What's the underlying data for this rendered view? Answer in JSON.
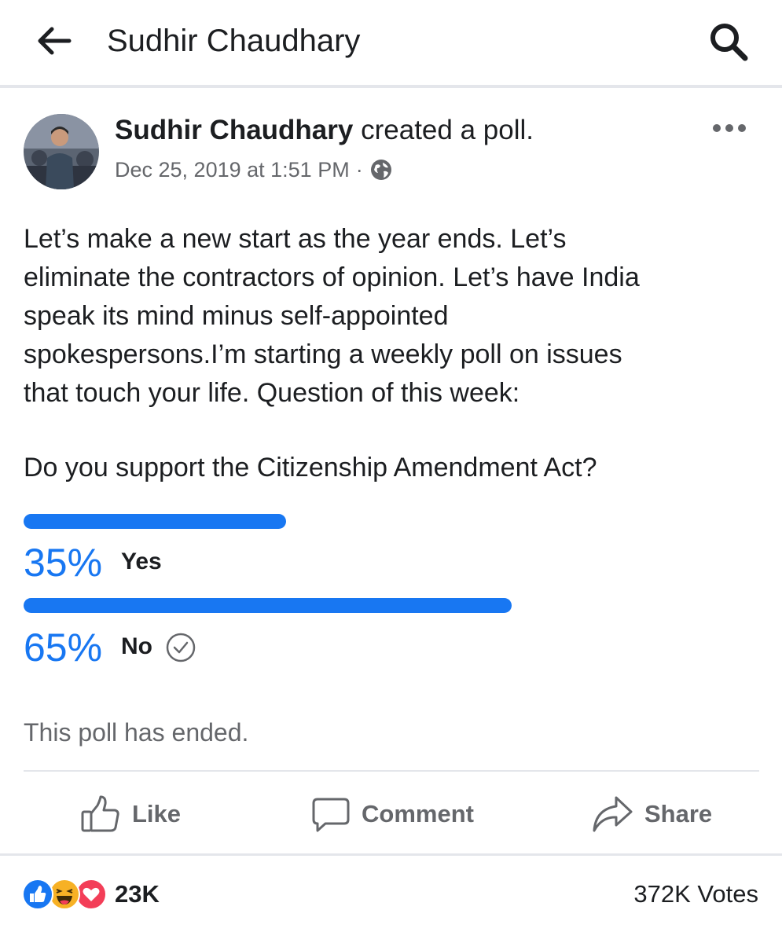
{
  "header": {
    "title": "Sudhir Chaudhary",
    "back_icon": "arrow-left-icon",
    "search_icon": "search-icon"
  },
  "post": {
    "author": "Sudhir Chaudhary",
    "action": "created a poll.",
    "timestamp": "Dec 25, 2019 at 1:51 PM",
    "separator": "·",
    "privacy_icon": "globe-icon",
    "more_icon": "more-horizontal-icon",
    "text_lines": [
      "Let’s make a new start as the year ends. Let’s",
      "eliminate the contractors of opinion. Let’s have India",
      "speak its mind minus self-appointed",
      "spokespersons.I’m starting a weekly poll on issues",
      "that touch your life. Question of this week:"
    ],
    "question": "Do you support the Citizenship Amendment Act?"
  },
  "poll": {
    "options": [
      {
        "percent_text": "35%",
        "label": "Yes",
        "fraction": 0.35
      },
      {
        "percent_text": "65%",
        "label": "No",
        "fraction": 0.65,
        "selected_icon": "check-circle-icon"
      }
    ],
    "status": "This poll has ended."
  },
  "actions": {
    "like_label": "Like",
    "comment_label": "Comment",
    "share_label": "Share"
  },
  "footer": {
    "reaction_icons": [
      "like-reaction-icon",
      "haha-reaction-icon",
      "love-reaction-icon"
    ],
    "reaction_count": "23K",
    "votes": "372K Votes"
  },
  "colors": {
    "accent": "#1877f2",
    "secondary_text": "#65676b",
    "divider": "#e4e6eb",
    "love": "#f33e58",
    "haha": "#f7b125"
  }
}
